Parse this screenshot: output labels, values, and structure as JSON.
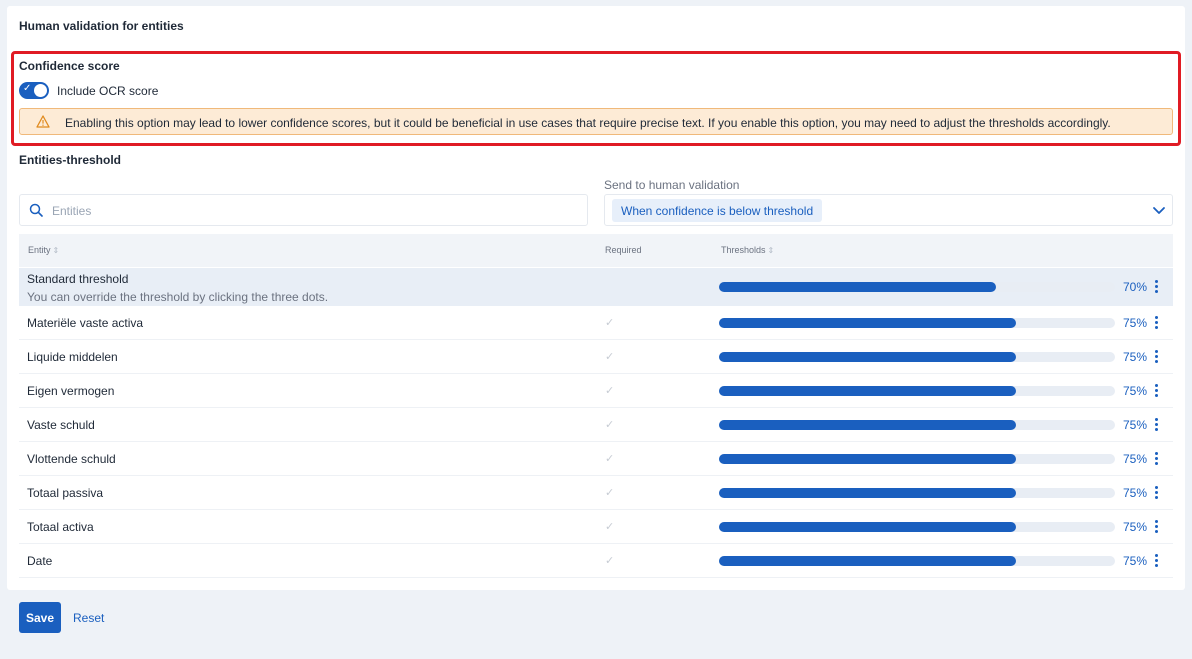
{
  "header": {
    "title": "Human validation for entities"
  },
  "confidence": {
    "title": "Confidence score",
    "toggle_on": true,
    "toggle_label": "Include OCR score",
    "warning_text": "Enabling this option may lead to lower confidence scores, but it could be beneficial in use cases that require precise text. If you enable this option, you may need to adjust the thresholds accordingly."
  },
  "entities": {
    "title": "Entities-threshold",
    "search_placeholder": "Entities",
    "send_label": "Send to human validation",
    "send_value": "When confidence is below threshold"
  },
  "table": {
    "headers": {
      "entity": "Entity",
      "required": "Required",
      "thresholds": "Thresholds"
    },
    "standard": {
      "name": "Standard threshold",
      "description": "You can override the threshold by clicking the three dots.",
      "value": 0.7,
      "label": "70%"
    },
    "rows": [
      {
        "name": "Materiële vaste activa",
        "value": 0.75,
        "label": "75%"
      },
      {
        "name": "Liquide middelen",
        "value": 0.75,
        "label": "75%"
      },
      {
        "name": "Eigen vermogen",
        "value": 0.75,
        "label": "75%"
      },
      {
        "name": "Vaste schuld",
        "value": 0.75,
        "label": "75%"
      },
      {
        "name": "Vlottende schuld",
        "value": 0.75,
        "label": "75%"
      },
      {
        "name": "Totaal passiva",
        "value": 0.75,
        "label": "75%"
      },
      {
        "name": "Totaal activa",
        "value": 0.75,
        "label": "75%"
      },
      {
        "name": "Date",
        "value": 0.75,
        "label": "75%"
      }
    ]
  },
  "footer": {
    "save_label": "Save",
    "reset_label": "Reset"
  },
  "colors": {
    "accent": "#1a5fbf",
    "warning_bg": "#fdebd6",
    "highlight_border": "#e01b24"
  },
  "icons": {
    "search": "search-icon",
    "warning": "warning-icon",
    "chevron": "chevron-down-icon",
    "more": "more-vertical-icon",
    "check": "check-icon"
  }
}
